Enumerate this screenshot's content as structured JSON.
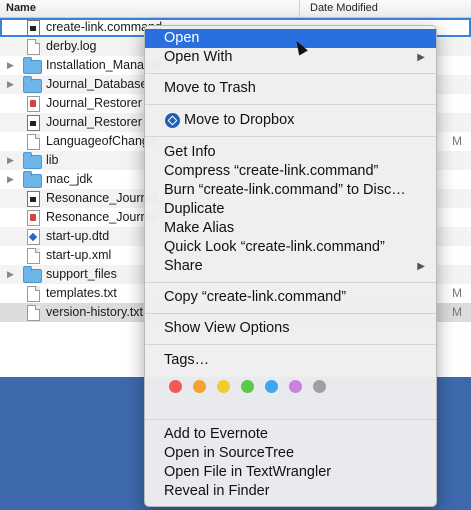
{
  "finder": {
    "col_name": "Name",
    "col_date": "Date Modified",
    "rows": [
      {
        "name": "create-link.command",
        "date": "",
        "type": "cmd",
        "folder": false
      },
      {
        "name": "derby.log",
        "date": "",
        "type": "doc",
        "folder": false
      },
      {
        "name": "Installation_Manager",
        "date": "",
        "type": "folder",
        "folder": true
      },
      {
        "name": "Journal_Database",
        "date": "",
        "type": "folder",
        "folder": true
      },
      {
        "name": "Journal_Restorer",
        "date": "",
        "type": "java",
        "folder": false
      },
      {
        "name": "Journal_Restorer",
        "date": "",
        "type": "cmd",
        "folder": false
      },
      {
        "name": "LanguageofChange",
        "date": "M",
        "type": "doc",
        "folder": false
      },
      {
        "name": "lib",
        "date": "",
        "type": "folder",
        "folder": true
      },
      {
        "name": "mac_jdk",
        "date": "",
        "type": "folder",
        "folder": true
      },
      {
        "name": "Resonance_Journal",
        "date": "",
        "type": "cmd",
        "folder": false
      },
      {
        "name": "Resonance_Journal",
        "date": "",
        "type": "java",
        "folder": false
      },
      {
        "name": "start-up.dtd",
        "date": "",
        "type": "dtd",
        "folder": false
      },
      {
        "name": "start-up.xml",
        "date": "",
        "type": "doc",
        "folder": false
      },
      {
        "name": "support_files",
        "date": "",
        "type": "folder",
        "folder": true
      },
      {
        "name": "templates.txt",
        "date": "M",
        "type": "doc",
        "folder": false
      },
      {
        "name": "version-history.txt",
        "date": "M",
        "type": "doc",
        "folder": false
      }
    ]
  },
  "menu": {
    "open": "Open",
    "open_with": "Open With",
    "move_to_trash": "Move to Trash",
    "move_to_dropbox": "Move to Dropbox",
    "get_info": "Get Info",
    "compress": "Compress “create-link.command”",
    "burn": "Burn “create-link.command” to Disc…",
    "duplicate": "Duplicate",
    "make_alias": "Make Alias",
    "quick_look": "Quick Look “create-link.command”",
    "share": "Share",
    "copy": "Copy “create-link.command”",
    "show_view_options": "Show View Options",
    "tags": "Tags…",
    "tag_colors": [
      "#f05a5a",
      "#f5a030",
      "#f0cc30",
      "#5ac84a",
      "#3ca8f0",
      "#cc80e0",
      "#a0a0a0"
    ],
    "add_to_evernote": "Add to Evernote",
    "open_in_sourcetree": "Open in SourceTree",
    "open_in_textwrangler": "Open File in TextWrangler",
    "reveal_in_finder": "Reveal in Finder"
  }
}
